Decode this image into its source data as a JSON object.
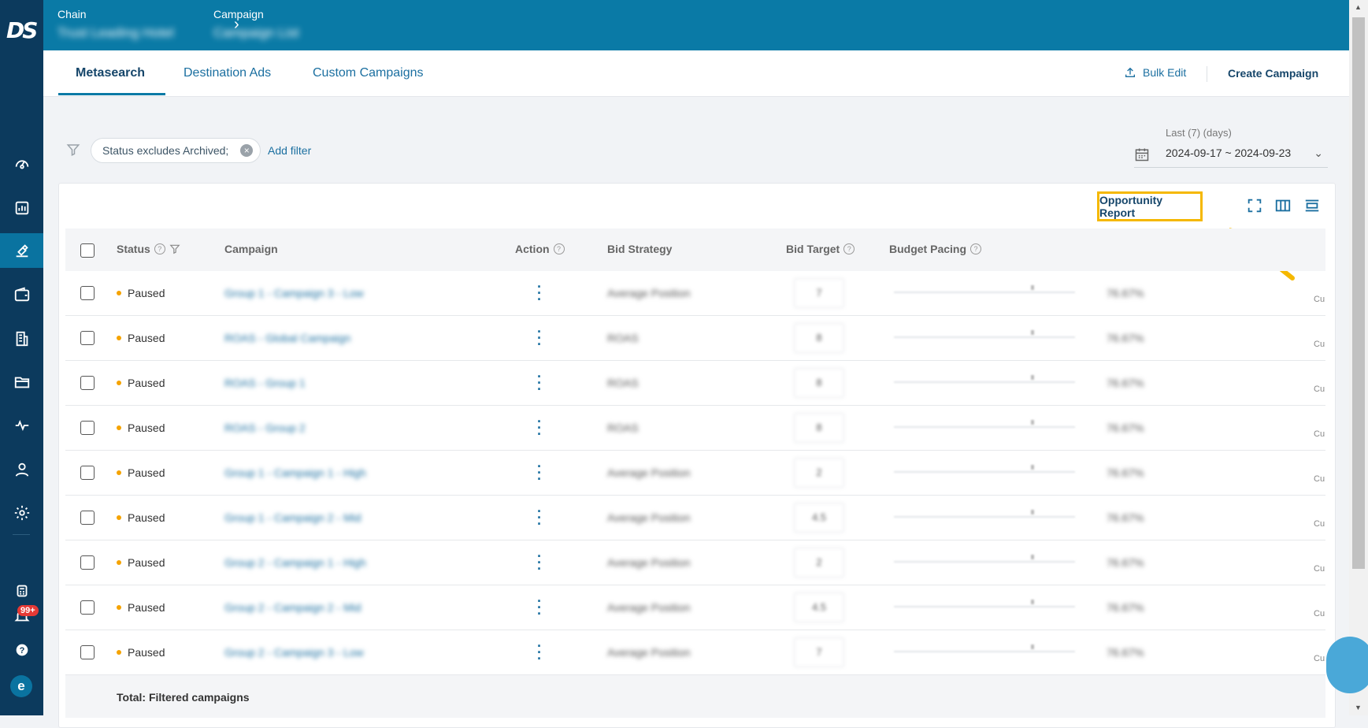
{
  "header": {
    "breadcrumb": [
      {
        "label": "Chain",
        "value": "Trust Leading Hotel"
      },
      {
        "label": "Campaign",
        "value": "Campaign List"
      }
    ],
    "logo": "DS"
  },
  "sidebar": {
    "items": [
      "dashboard-icon",
      "report-icon",
      "campaign-icon",
      "wallet-icon",
      "building-icon",
      "folder-icon",
      "activity-icon",
      "user-icon",
      "settings-icon"
    ],
    "notification_badge": "99+",
    "avatar_letter": "e"
  },
  "tabs": [
    {
      "label": "Metasearch",
      "active": true
    },
    {
      "label": "Destination Ads",
      "active": false
    },
    {
      "label": "Custom Campaigns",
      "active": false
    }
  ],
  "actions": {
    "bulk_edit": "Bulk Edit",
    "create_campaign": "Create Campaign"
  },
  "filters": {
    "chip": "Status excludes Archived;",
    "add_filter": "Add filter"
  },
  "date_range": {
    "label": "Last (7) (days)",
    "value": "2024-09-17 ~ 2024-09-23"
  },
  "toolbar": {
    "opportunity_report": "Opportunity Report"
  },
  "table": {
    "columns": {
      "status": "Status",
      "campaign": "Campaign",
      "action": "Action",
      "bid_strategy": "Bid Strategy",
      "bid_target": "Bid Target",
      "budget_pacing": "Budget Pacing"
    },
    "rows": [
      {
        "status": "Paused",
        "campaign": "Group 1 - Campaign 3 - Low",
        "bid_strategy": "Average Position",
        "bid_target": "7",
        "pacing": "76.67%",
        "extra": "Cu"
      },
      {
        "status": "Paused",
        "campaign": "ROAS - Global Campaign",
        "bid_strategy": "ROAS",
        "bid_target": "8",
        "pacing": "76.67%",
        "extra": "Cu"
      },
      {
        "status": "Paused",
        "campaign": "ROAS - Group 1",
        "bid_strategy": "ROAS",
        "bid_target": "8",
        "pacing": "76.67%",
        "extra": "Cu"
      },
      {
        "status": "Paused",
        "campaign": "ROAS - Group 2",
        "bid_strategy": "ROAS",
        "bid_target": "8",
        "pacing": "76.67%",
        "extra": "Cu"
      },
      {
        "status": "Paused",
        "campaign": "Group 1 - Campaign 1 - High",
        "bid_strategy": "Average Position",
        "bid_target": "2",
        "pacing": "76.67%",
        "extra": "Cu"
      },
      {
        "status": "Paused",
        "campaign": "Group 1 - Campaign 2 - Mid",
        "bid_strategy": "Average Position",
        "bid_target": "4.5",
        "pacing": "76.67%",
        "extra": "Cu"
      },
      {
        "status": "Paused",
        "campaign": "Group 2 - Campaign 1 - High",
        "bid_strategy": "Average Position",
        "bid_target": "2",
        "pacing": "76.67%",
        "extra": "Cu"
      },
      {
        "status": "Paused",
        "campaign": "Group 2 - Campaign 2 - Mid",
        "bid_strategy": "Average Position",
        "bid_target": "4.5",
        "pacing": "76.67%",
        "extra": "Cu"
      },
      {
        "status": "Paused",
        "campaign": "Group 2 - Campaign 3 - Low",
        "bid_strategy": "Average Position",
        "bid_target": "7",
        "pacing": "76.67%",
        "extra": "Cu"
      }
    ],
    "total_label": "Total: Filtered campaigns"
  },
  "colors": {
    "header": "#0a7aa6",
    "sidebar": "#0c3a5d",
    "highlight": "#f5b800",
    "status_paused": "#f5a300"
  }
}
